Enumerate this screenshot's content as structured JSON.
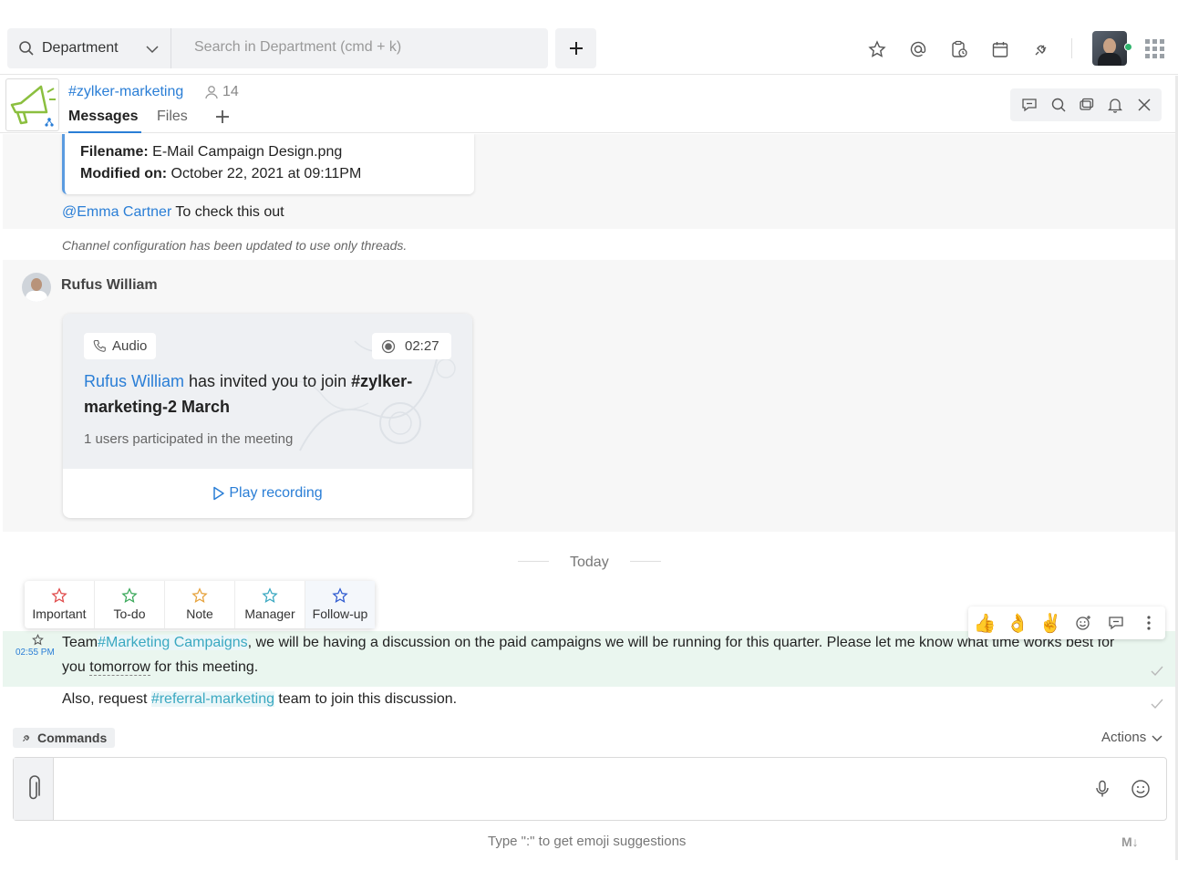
{
  "topbar": {
    "department_label": "Department",
    "search_placeholder": "Search in Department (cmd + k)"
  },
  "channel": {
    "name": "#zylker-marketing",
    "member_count": "14",
    "tabs": [
      {
        "label": "Messages",
        "active": true
      },
      {
        "label": "Files",
        "active": false
      }
    ]
  },
  "messages": {
    "file_card": {
      "filename_label": "Filename:",
      "filename_value": "E-Mail Campaign Design.png",
      "modified_label": "Modified on:",
      "modified_value": "October 22, 2021 at 09:11PM"
    },
    "mention": {
      "name": "@Emma Cartner",
      "text": "To check this out"
    },
    "system_message": "Channel configuration has been updated to use only threads.",
    "rufus": {
      "name": "Rufus William",
      "call": {
        "type_label": "Audio",
        "duration": "02:27",
        "inviter": "Rufus William",
        "invite_text": " has invited you to join ",
        "meeting_name": "#zylker-marketing-2 March",
        "participants": "1 users participated in the meeting",
        "play_label": "Play recording"
      }
    },
    "day_divider": "Today",
    "tag_popup": [
      {
        "label": "Important",
        "color": "#e04a4a"
      },
      {
        "label": "To-do",
        "color": "#3aa85a"
      },
      {
        "label": "Note",
        "color": "#e6a23c"
      },
      {
        "label": "Manager",
        "color": "#3aa8c1"
      },
      {
        "label": "Follow-up",
        "color": "#2f5bd0"
      }
    ],
    "reactions": [
      "thumbs-up",
      "ok-hand",
      "victory-hand",
      "add-reaction",
      "reply-thread",
      "more-options"
    ],
    "latest": {
      "time": "02:55 PM",
      "part1": "Team",
      "hashtag": "#Marketing Campaigns",
      "part2": ", we will be having a discussion on the paid campaigns we will be running for this quarter. Please let me know what time works best for",
      "part3": "you ",
      "highlight_word": "tomorrow",
      "part4": " for this meeting."
    },
    "followup": {
      "part1": "Also, request ",
      "hashtag": "#referral-marketing",
      "part2": " team to join this discussion."
    }
  },
  "composer": {
    "commands_label": "Commands",
    "actions_label": "Actions",
    "emoji_hint": "Type \":\" to get emoji suggestions",
    "markdown_label": "M↓"
  },
  "colors": {
    "accent": "#2a7ed6",
    "hashtag": "#3aa8c1",
    "online": "#2fb36d"
  }
}
